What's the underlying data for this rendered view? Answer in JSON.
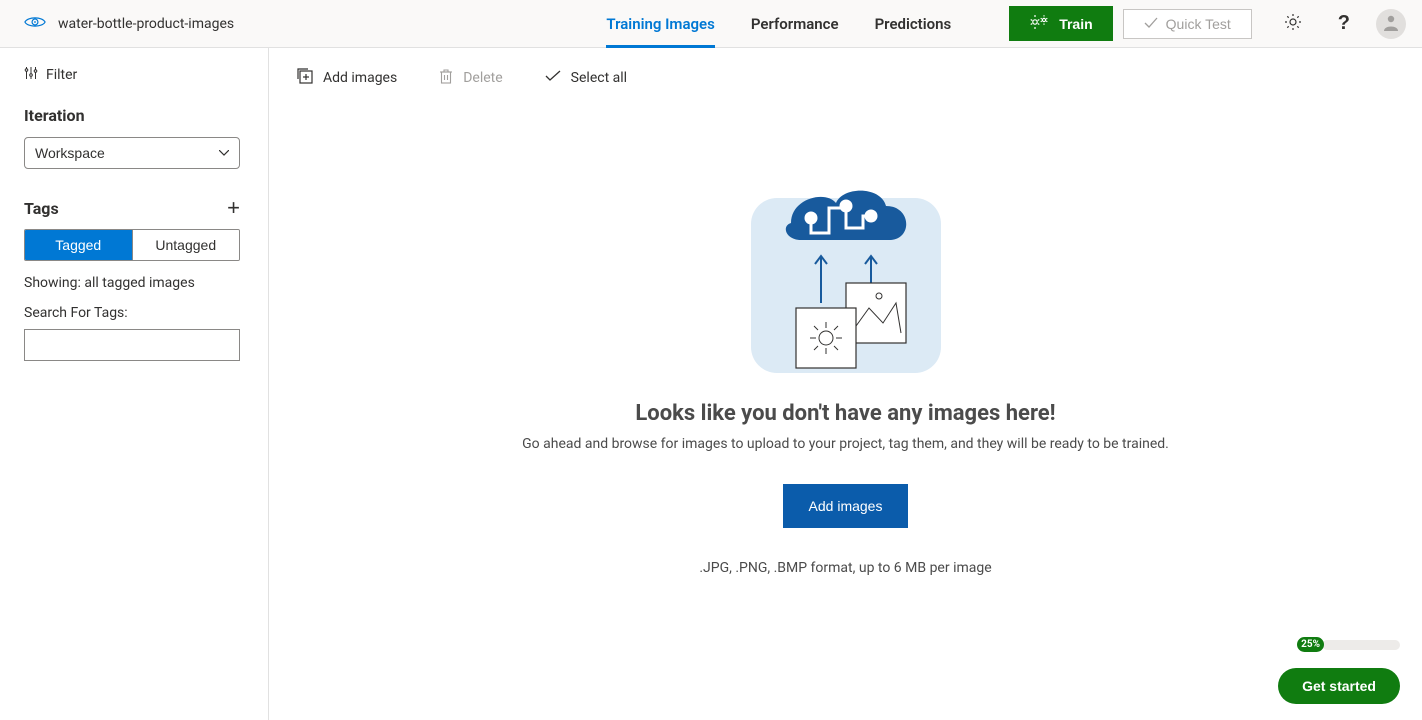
{
  "header": {
    "project_name": "water-bottle-product-images",
    "tabs": {
      "training": "Training Images",
      "performance": "Performance",
      "predictions": "Predictions"
    },
    "train_button": "Train",
    "quick_test_button": "Quick Test"
  },
  "sidebar": {
    "filter_label": "Filter",
    "iteration_label": "Iteration",
    "iteration_value": "Workspace",
    "tags_label": "Tags",
    "seg": {
      "tagged": "Tagged",
      "untagged": "Untagged"
    },
    "showing_text": "Showing: all tagged images",
    "search_label": "Search For Tags:"
  },
  "toolbar": {
    "add_images": "Add images",
    "delete": "Delete",
    "select_all": "Select all"
  },
  "empty": {
    "title": "Looks like you don't have any images here!",
    "subtitle": "Go ahead and browse for images to upload to your project, tag them, and they will be ready to be trained.",
    "add_button": "Add images",
    "hint": ".JPG, .PNG, .BMP format, up to 6 MB per image"
  },
  "footer": {
    "get_started": "Get started",
    "progress_pct": "25%"
  }
}
